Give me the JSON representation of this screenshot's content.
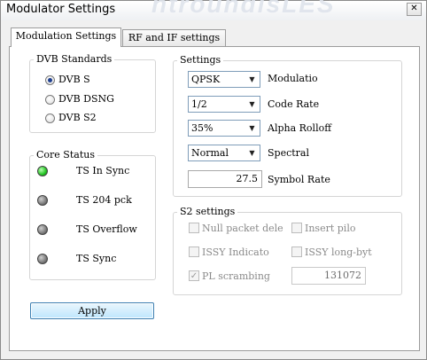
{
  "window": {
    "title": "Modulator Settings",
    "watermark": "ntroundisLES",
    "close_label": "✕"
  },
  "tabs": [
    {
      "label": "Modulation Settings",
      "active": true
    },
    {
      "label": "RF and IF settings",
      "active": false
    }
  ],
  "dvb_standards": {
    "title": "DVB Standards",
    "options": [
      {
        "label": "DVB S",
        "checked": true
      },
      {
        "label": "DVB DSNG",
        "checked": false
      },
      {
        "label": "DVB S2",
        "checked": false
      }
    ]
  },
  "core_status": {
    "title": "Core Status",
    "items": [
      {
        "label": "TS In Sync",
        "state": "on",
        "color": "#22c422"
      },
      {
        "label": "TS 204 pck",
        "state": "off",
        "color": "#7b7b7b"
      },
      {
        "label": "TS Overflow",
        "state": "off",
        "color": "#7b7b7b"
      },
      {
        "label": "TS Sync",
        "state": "off",
        "color": "#7b7b7b"
      }
    ]
  },
  "settings": {
    "title": "Settings",
    "fields": [
      {
        "value": "QPSK",
        "label": "Modulatio"
      },
      {
        "value": "1/2",
        "label": "Code Rate"
      },
      {
        "value": "35%",
        "label": "Alpha Rolloff"
      },
      {
        "value": "Normal",
        "label": "Spectral"
      }
    ],
    "symbol_rate": {
      "value": "27.5",
      "label": "Symbol Rate"
    }
  },
  "s2_settings": {
    "title": "S2 settings",
    "checks": [
      {
        "label": "Null packet dele",
        "checked": false
      },
      {
        "label": "Insert pilo",
        "checked": false
      },
      {
        "label": "ISSY Indicato",
        "checked": false
      },
      {
        "label": "ISSY long-byt",
        "checked": false
      },
      {
        "label": "PL scrambing",
        "checked": true
      }
    ],
    "pl_value": "131072"
  },
  "apply_label": "Apply",
  "icons": {
    "close": "close-icon",
    "dropdown": "chevron-down-icon",
    "check": "checkmark-icon"
  }
}
